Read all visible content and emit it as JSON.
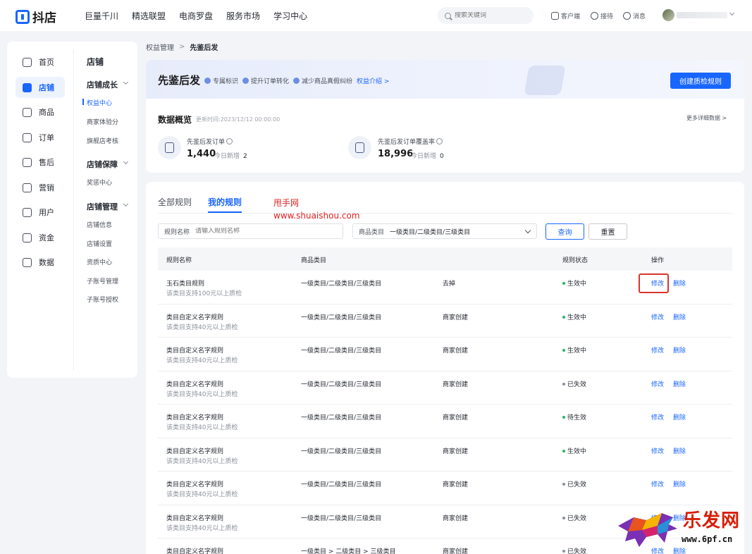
{
  "brand": {
    "name": "抖店"
  },
  "top_nav": [
    "巨量千川",
    "精选联盟",
    "电商罗盘",
    "服务市场",
    "学习中心"
  ],
  "search": {
    "placeholder": "搜索关键词"
  },
  "top_actions": {
    "client": "客户端",
    "reception": "接待",
    "messages": "消息"
  },
  "sidebar": {
    "primary": [
      "首页",
      "店铺",
      "商品",
      "订单",
      "售后",
      "营销",
      "用户",
      "资金",
      "数据"
    ],
    "active_primary": "店铺",
    "title": "店铺",
    "groups": [
      {
        "label": "店铺成长",
        "items": [
          "权益中心",
          "商家体验分",
          "旗舰店考核"
        ]
      },
      {
        "label": "店铺保障",
        "items": [
          "奖惩中心"
        ]
      },
      {
        "label": "店铺管理",
        "items": [
          "店铺信息",
          "店铺设置",
          "资质中心",
          "子账号管理",
          "子账号授权"
        ]
      }
    ],
    "active_sub": "权益中心"
  },
  "breadcrumb": {
    "parent": "权益管理",
    "sep": ">",
    "current": "先鉴后发"
  },
  "hero": {
    "title": "先鉴后发",
    "tags": [
      "专属标识",
      "提升订单转化",
      "减少商品真假纠纷"
    ],
    "intro_link": "权益介绍 >",
    "create_button": "创建质检规则"
  },
  "overview": {
    "title": "数据概览",
    "update_time": "更新时间:2023/12/12 00:00:00",
    "more": "更多详细数据 >",
    "metrics": [
      {
        "label": "先鉴后发订单",
        "value": "1,440",
        "today_label": "今日新增",
        "today": "2"
      },
      {
        "label": "先鉴后发订单覆盖率",
        "value": "18,996",
        "today_label": "今日新增",
        "today": "0"
      }
    ]
  },
  "rules": {
    "tabs": [
      "全部规则",
      "我的规则"
    ],
    "active_tab": "我的规则",
    "watermark": [
      "甩手网",
      "www.shuaishou.com"
    ],
    "filters": {
      "name_label": "规则名称",
      "name_placeholder": "请输入规则名称",
      "category_label": "商品类目",
      "category_value": "一级类目/二级类目/三级类目",
      "query": "查询",
      "reset": "重置"
    },
    "columns": [
      "规则名称",
      "商品类目",
      "规则状态",
      "操作"
    ],
    "status_colors": {
      "生效中": "#27b564",
      "已失效": "#8a8f99",
      "待生效": "#27b564"
    },
    "rows": [
      {
        "name": "玉石类目规则",
        "desc": "该类目支持100元以上质检",
        "category": "一级类目/二级类目/三级类目",
        "source": "去掉",
        "status": "生效中",
        "edit": "修改",
        "delete": "删除"
      },
      {
        "name": "类目自定义名字规则",
        "desc": "该类目支持40元以上质检",
        "category": "一级类目/二级类目/三级类目",
        "source": "商家创建",
        "status": "生效中",
        "edit": "修改",
        "delete": "删除"
      },
      {
        "name": "类目自定义名字规则",
        "desc": "该类目支持40元以上质检",
        "category": "一级类目/二级类目/三级类目",
        "source": "商家创建",
        "status": "生效中",
        "edit": "修改",
        "delete": "删除"
      },
      {
        "name": "类目自定义名字规则",
        "desc": "该类目支持40元以上质检",
        "category": "一级类目/二级类目/三级类目",
        "source": "商家创建",
        "status": "已失效",
        "edit": "修改",
        "delete": "删除"
      },
      {
        "name": "类目自定义名字规则",
        "desc": "该类目支持40元以上质检",
        "category": "一级类目/二级类目/三级类目",
        "source": "商家创建",
        "status": "待生效",
        "edit": "修改",
        "delete": "删除"
      },
      {
        "name": "类目自定义名字规则",
        "desc": "该类目支持40元以上质检",
        "category": "一级类目/二级类目/三级类目",
        "source": "商家创建",
        "status": "生效中",
        "edit": "修改",
        "delete": "删除"
      },
      {
        "name": "类目自定义名字规则",
        "desc": "该类目支持40元以上质检",
        "category": "一级类目/二级类目/三级类目",
        "source": "商家创建",
        "status": "已失效",
        "edit": "修改",
        "delete": "删除"
      },
      {
        "name": "类目自定义名字规则",
        "desc": "该类目支持40元以上质检",
        "category": "一级类目/二级类目/三级类目",
        "source": "商家创建",
        "status": "已失效",
        "edit": "修改",
        "delete": "删除"
      },
      {
        "name": "类目自定义名字规则",
        "desc": "",
        "category": "一级类目 > 二级类目 > 三级类目",
        "source": "商家创建",
        "status": "已失效",
        "edit": "修改",
        "delete": "删除"
      }
    ]
  },
  "corner_logo": {
    "cn": "乐发网",
    "url": "www.6pf.cn"
  }
}
